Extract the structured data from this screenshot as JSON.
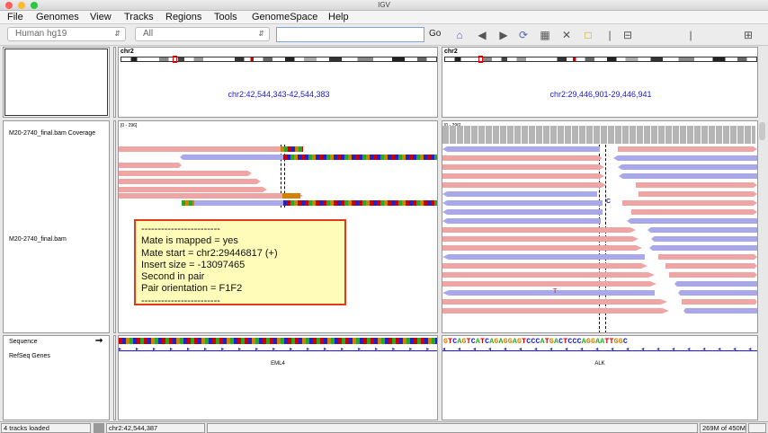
{
  "window": {
    "title": "IGV"
  },
  "menu": [
    "File",
    "Genomes",
    "View",
    "Tracks",
    "Regions",
    "Tools",
    "GenomeSpace",
    "Help"
  ],
  "toolbar": {
    "genome": "Human hg19",
    "chromosome": "All",
    "locus_value": "",
    "go_label": "Go"
  },
  "panels": [
    {
      "chrom": "chr2",
      "locus": "chr2:42,544,343-42,544,383",
      "range": "[0 - 296]",
      "gene": "EML4"
    },
    {
      "chrom": "chr2",
      "locus": "chr2:29,446,901-29,446,941",
      "range": "[0 - 296]",
      "gene": "ALK"
    }
  ],
  "tracks": {
    "coverage": "M20-2740_final.bam Coverage",
    "alignment": "M20-2740_final.bam",
    "sequence": "Sequence",
    "genes": "RefSeq Genes"
  },
  "popup": {
    "separator": "------------------------",
    "lines": [
      "Mate is mapped = yes",
      "Mate start = chr2:29446817 (+)",
      "Insert size = -13097465",
      "Second in pair",
      "Pair orientation = F1F2"
    ]
  },
  "sequence_right": "GTCAGTCATCAGAGGAGTCCCATGACTCCCAGGAATTGGC",
  "mismatch_labels": {
    "c": "C",
    "t": "T"
  },
  "status": {
    "tracks_loaded": "4 tracks loaded",
    "position": "chr2:42,544,387",
    "memory": "269M of 450M"
  },
  "colors": {
    "forward_read": "#f0a5a5",
    "reverse_read": "#a8a8ea",
    "locus_text": "#1a1ad0",
    "popup_border": "#e03a1a",
    "popup_bg": "#fffbb8"
  }
}
